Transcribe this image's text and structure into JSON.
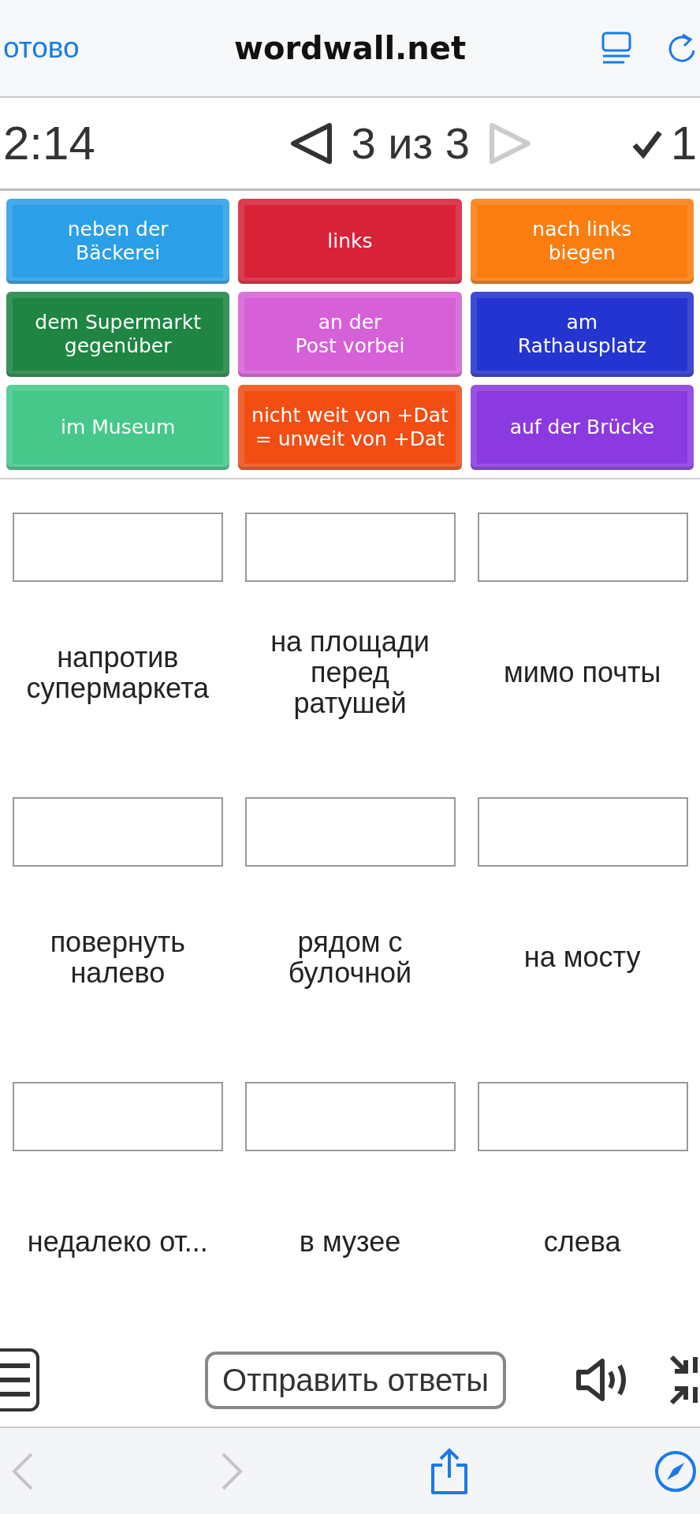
{
  "browser": {
    "done_label": "отово",
    "url": "wordwall.net"
  },
  "game": {
    "timer": "2:14",
    "page": "3 из 3",
    "prev_enabled": true,
    "next_enabled": false,
    "score": "1"
  },
  "tiles": [
    {
      "label": "neben der\nBäckerei",
      "color": "#2b9fe8"
    },
    {
      "label": "links",
      "color": "#d82238"
    },
    {
      "label": "nach links\nbiegen",
      "color": "#fb7d0f"
    },
    {
      "label": "dem Supermarkt\ngegenüber",
      "color": "#1e8543"
    },
    {
      "label": "an der\nPost vorbei",
      "color": "#d660d8"
    },
    {
      "label": "am\nRathausplatz",
      "color": "#2434d0"
    },
    {
      "label": "im Museum",
      "color": "#45c88a"
    },
    {
      "label": "nicht weit von +Dat\n= unweit von +Dat",
      "color": "#f24e14"
    },
    {
      "label": "auf der Brücke",
      "color": "#8a3ae0"
    }
  ],
  "targets": [
    {
      "label": "напротив\nсупермаркета"
    },
    {
      "label": "на площади\nперед\nратушей"
    },
    {
      "label": "мимо почты"
    },
    {
      "label": "повернуть\nналево"
    },
    {
      "label": "рядом с\nбулочной"
    },
    {
      "label": "на мосту"
    },
    {
      "label": "недалеко от..."
    },
    {
      "label": "в музее"
    },
    {
      "label": "слева"
    }
  ],
  "toolbar": {
    "submit": "Отправить ответы"
  },
  "browser_bar": {
    "back_disabled": true,
    "forward_disabled": true
  }
}
